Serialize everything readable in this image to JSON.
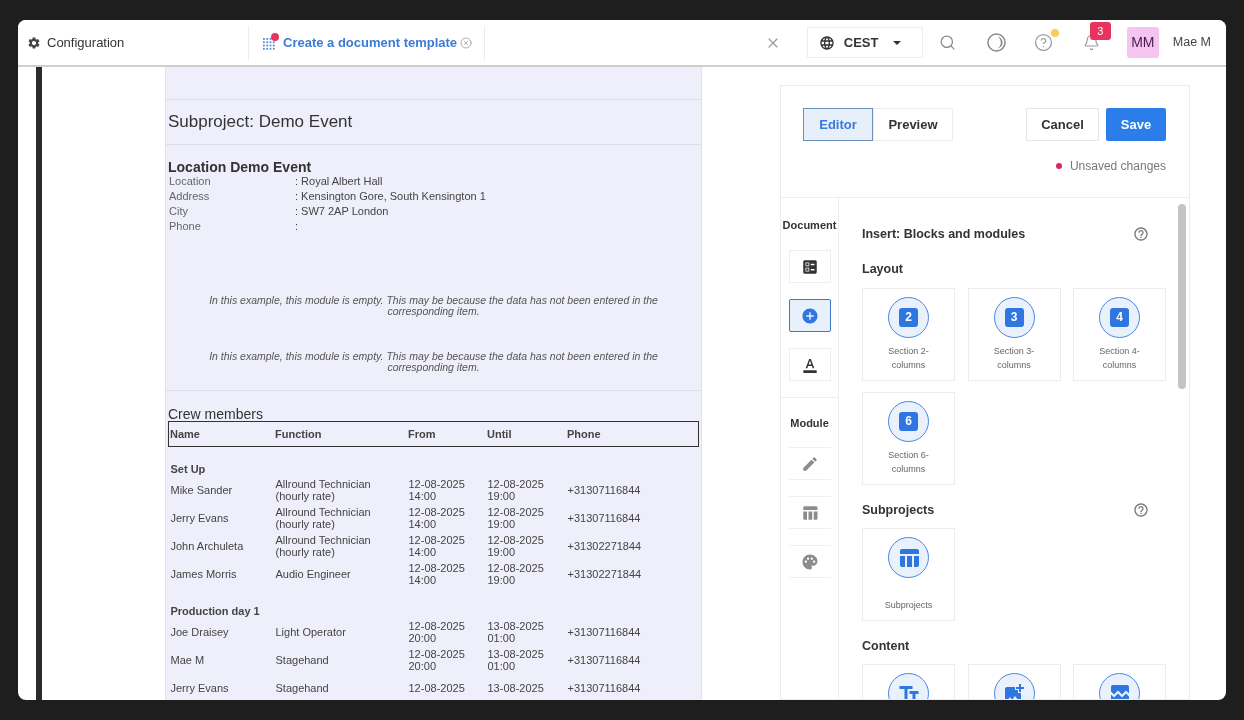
{
  "topbar": {
    "section": "Configuration",
    "tab": {
      "label": "Create a document template",
      "unsaved": true
    },
    "timezone": "CEST",
    "help": {
      "has_news": true
    },
    "notifications": {
      "count": "3"
    },
    "user": {
      "initials": "MM",
      "name": "Mae M"
    }
  },
  "document": {
    "title": "Subproject: Demo Event",
    "location": {
      "heading": "Location Demo Event",
      "rows": [
        {
          "label": "Location",
          "value": ": Royal Albert Hall"
        },
        {
          "label": "Address",
          "value": ": Kensington Gore, South Kensington 1"
        },
        {
          "label": "City",
          "value": ": SW7 2AP London"
        },
        {
          "label": "Phone",
          "value": ":"
        }
      ]
    },
    "notes": [
      "In this example, this module is empty. This may be because the data has not been entered in the corresponding item.",
      "In this example, this module is empty. This may be because the data has not been entered in the corresponding item."
    ],
    "crew": {
      "heading": "Crew members",
      "columns": [
        "Name",
        "Function",
        "From",
        "Until",
        "Phone"
      ],
      "groups": [
        {
          "name": "Set Up",
          "rows": [
            [
              "Mike Sander",
              "Allround Technician (hourly rate)",
              "12-08-2025 14:00",
              "12-08-2025 19:00",
              "+31307116844"
            ],
            [
              "Jerry Evans",
              "Allround Technician (hourly rate)",
              "12-08-2025 14:00",
              "12-08-2025 19:00",
              "+31307116844"
            ],
            [
              "John Archuleta",
              "Allround Technician (hourly rate)",
              "12-08-2025 14:00",
              "12-08-2025 19:00",
              "+31302271844"
            ],
            [
              "James Morris",
              "Audio Engineer",
              "12-08-2025 14:00",
              "12-08-2025 19:00",
              "+31302271844"
            ]
          ]
        },
        {
          "name": "Production day 1",
          "rows": [
            [
              "Joe Draisey",
              "Light Operator",
              "12-08-2025 20:00",
              "13-08-2025 01:00",
              "+31307116844"
            ],
            [
              "Mae M",
              "Stagehand",
              "12-08-2025 20:00",
              "13-08-2025 01:00",
              "+31307116844"
            ],
            [
              "Jerry Evans",
              "Stagehand",
              "12-08-2025",
              "13-08-2025",
              "+31307116844"
            ]
          ]
        }
      ]
    }
  },
  "editor_panel": {
    "modes": [
      {
        "label": "Editor",
        "selected": true
      },
      {
        "label": "Preview",
        "selected": false
      }
    ],
    "actions": [
      {
        "label": "Cancel",
        "kind": "secondary"
      },
      {
        "label": "Save",
        "kind": "primary"
      }
    ],
    "status": "Unsaved changes",
    "rail": [
      {
        "label": "Document",
        "tools": [
          {
            "kind": "fields",
            "selected": false,
            "disabled": false
          },
          {
            "kind": "insert",
            "selected": true,
            "disabled": false
          },
          {
            "kind": "text",
            "selected": false,
            "disabled": false
          }
        ]
      },
      {
        "label": "Module",
        "tools": [
          {
            "kind": "edit",
            "selected": false,
            "disabled": true
          },
          {
            "kind": "table",
            "selected": false,
            "disabled": true
          },
          {
            "kind": "style",
            "selected": false,
            "disabled": true
          }
        ]
      }
    ],
    "insert": {
      "title": "Insert: Blocks and modules",
      "help": true,
      "sections": [
        {
          "heading": "Layout",
          "help": false,
          "blocks": [
            {
              "kind": "columns",
              "number": "2",
              "label": "Section 2-columns"
            },
            {
              "kind": "columns",
              "number": "3",
              "label": "Section 3-columns"
            },
            {
              "kind": "columns",
              "number": "4",
              "label": "Section 4-columns"
            },
            {
              "kind": "columns",
              "number": "6",
              "label": "Section 6-columns"
            }
          ]
        },
        {
          "heading": "Subprojects",
          "help": true,
          "blocks": [
            {
              "kind": "subprojects",
              "label": "Subprojects"
            }
          ]
        },
        {
          "heading": "Content",
          "help": false,
          "blocks": [
            {
              "kind": "text"
            },
            {
              "kind": "image"
            },
            {
              "kind": "picture"
            }
          ]
        }
      ]
    }
  }
}
